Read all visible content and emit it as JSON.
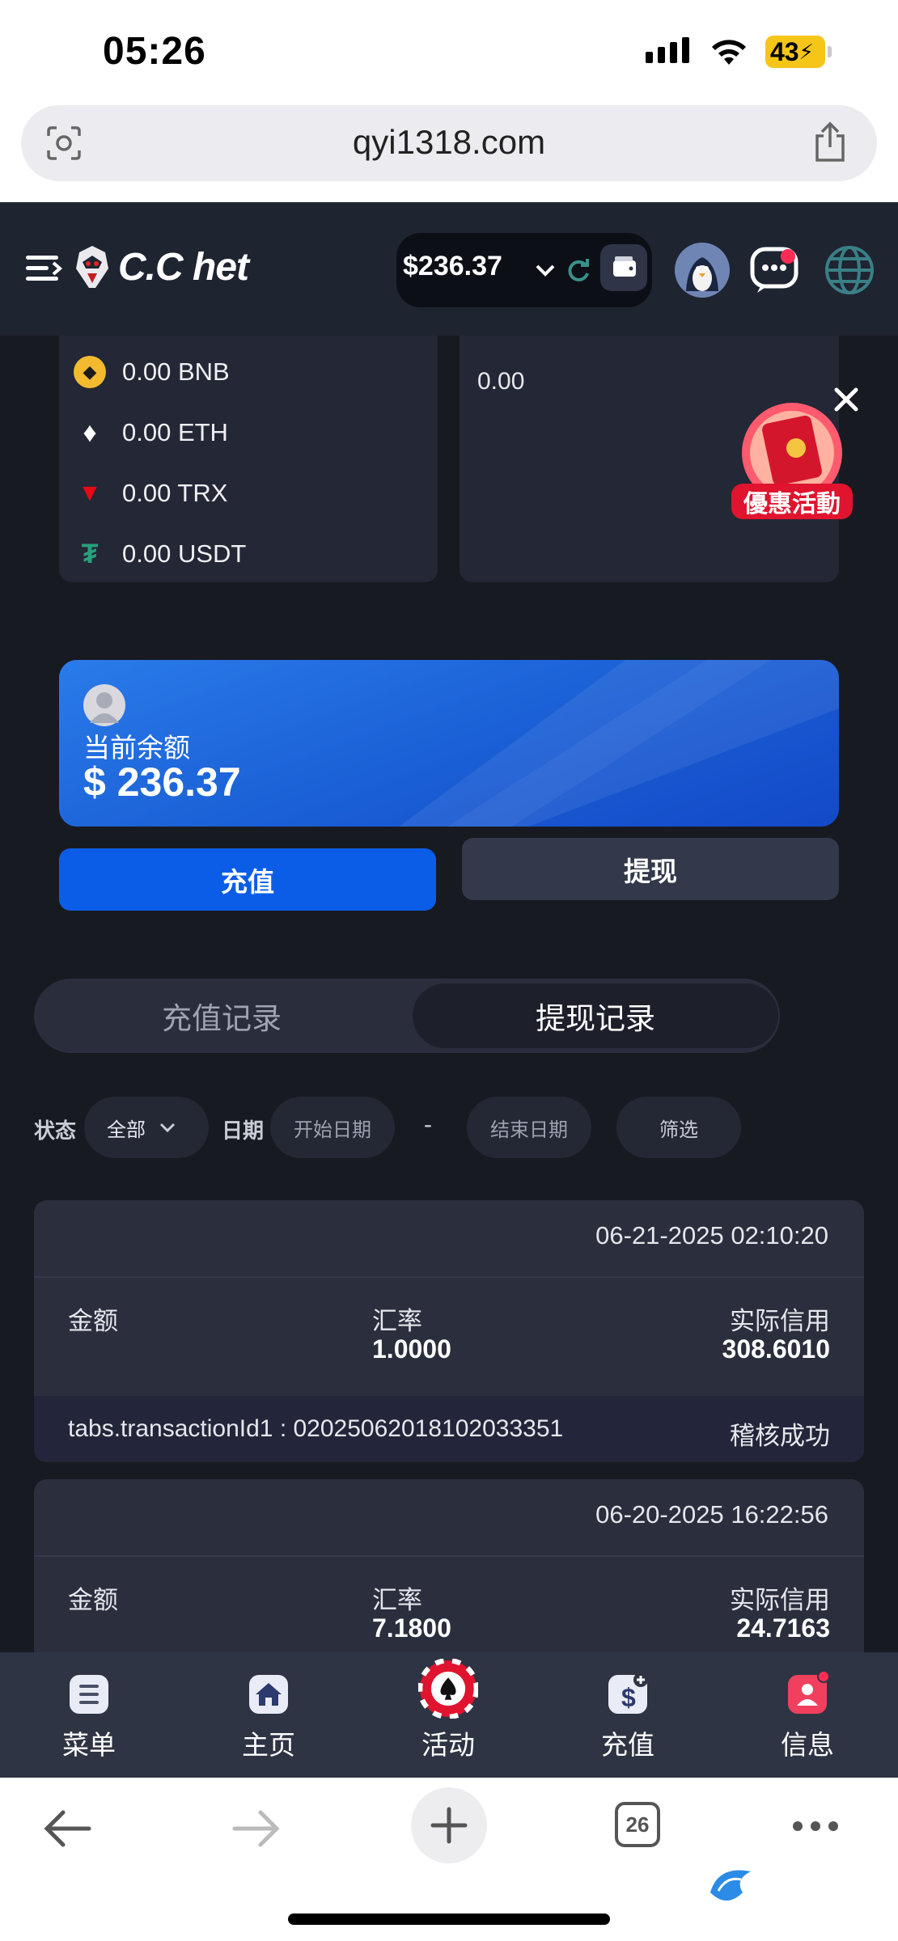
{
  "status_bar": {
    "time": "05:26",
    "battery": "43"
  },
  "browser": {
    "url": "qyi1318.com",
    "tab_count": "26"
  },
  "header": {
    "logo_text": "C.C het",
    "balance": "$236.37"
  },
  "crypto_balances": [
    {
      "amount": "0.00 BNB",
      "icon": "bnb-icon",
      "color": "#f3ba2f"
    },
    {
      "amount": "0.00 ETH",
      "icon": "eth-icon",
      "color": "#ffffff"
    },
    {
      "amount": "0.00 TRX",
      "icon": "trx-icon",
      "color": "#e50915"
    },
    {
      "amount": "0.00 USDT",
      "icon": "usdt-icon",
      "color": "#26a17b"
    }
  ],
  "right_card": {
    "value": "0.00"
  },
  "promo": {
    "label": "優惠活動"
  },
  "balance_card": {
    "label": "当前余额",
    "amount": "$ 236.37"
  },
  "actions": {
    "deposit": "充值",
    "withdraw": "提现"
  },
  "tabs": [
    {
      "label": "充值记录",
      "active": false
    },
    {
      "label": "提现记录",
      "active": true
    }
  ],
  "filters": {
    "status_label": "状态",
    "status_value": "全部",
    "date_label": "日期",
    "start_placeholder": "开始日期",
    "separator": "-",
    "end_placeholder": "结束日期",
    "filter_button": "筛选"
  },
  "records": [
    {
      "datetime": "06-21-2025 02:10:20",
      "amount_label": "金额",
      "rate_label": "汇率",
      "rate_value": "1.0000",
      "credit_label": "实际信用",
      "credit_value": "308.6010",
      "transaction": "tabs.transactionId1 : 020250620181020333​51",
      "status": "稽核成功"
    },
    {
      "datetime": "06-20-2025 16:22:56",
      "amount_label": "金额",
      "rate_label": "汇率",
      "rate_value": "7.1800",
      "credit_label": "实际信用",
      "credit_value": "24.7163"
    }
  ],
  "bottom_nav": [
    {
      "label": "菜单",
      "icon": "menu-list-icon"
    },
    {
      "label": "主页",
      "icon": "home-icon"
    },
    {
      "label": "活动",
      "icon": "poker-chip-icon"
    },
    {
      "label": "充值",
      "icon": "deposit-icon"
    },
    {
      "label": "信息",
      "icon": "message-icon"
    }
  ],
  "colors": {
    "background": "#181a22",
    "header": "#1f2431",
    "accent_blue": "#0b5de8",
    "card": "#2a2e3d"
  }
}
